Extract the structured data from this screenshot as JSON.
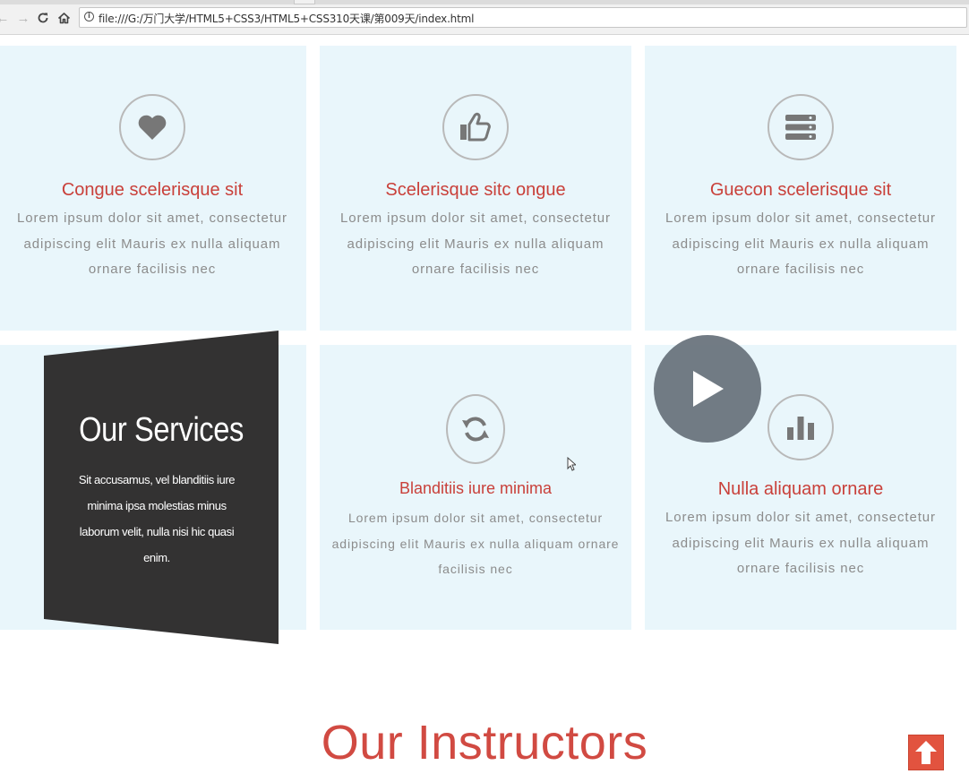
{
  "browser": {
    "url": "file:///G:/万门大学/HTML5+CSS3/HTML5+CSS310天课/第009天/index.html",
    "icons": [
      "back-icon",
      "forward-icon",
      "reload-icon",
      "home-icon",
      "info-icon"
    ]
  },
  "services": [
    {
      "icon": "heart-icon",
      "title": "Congue scelerisque sit",
      "text": "Lorem ipsum dolor sit amet, consectetur adipiscing elit Mauris ex nulla aliquam ornare facilisis nec"
    },
    {
      "icon": "thumbs-up-icon",
      "title": "Scelerisque sitc ongue",
      "text": "Lorem ipsum dolor sit amet, consectetur adipiscing elit Mauris ex nulla aliquam ornare facilisis nec"
    },
    {
      "icon": "server-icon",
      "title": "Guecon scelerisque sit",
      "text": "Lorem ipsum dolor sit amet, consectetur adipiscing elit Mauris ex nulla aliquam ornare facilisis nec"
    },
    {
      "icon": "refresh-icon",
      "title": "Blanditiis iure minima",
      "text": "Lorem ipsum dolor sit amet, consectetur adipiscing elit Mauris ex nulla aliquam ornare facilisis nec"
    },
    {
      "icon": "bar-chart-icon",
      "title": "Nulla aliquam ornare",
      "text": "Lorem ipsum dolor sit amet, consectetur adipiscing elit Mauris ex nulla aliquam ornare facilisis nec"
    }
  ],
  "overlay": {
    "title": "Our Services",
    "text": "Sit accusamus, vel blanditiis iure minima ipsa molestias minus laborum velit, nulla nisi hic quasi enim."
  },
  "play_button": {
    "icon": "play-icon"
  },
  "instructors": {
    "title": "Our Instructors"
  },
  "back_to_top": {
    "icon": "arrow-up-icon"
  },
  "colors": {
    "accent_red": "#c9403a",
    "card_bg": "#e9f6fb",
    "overlay_bg": "#333232",
    "body_text": "#8c8c8c",
    "back_to_top_bg": "#e2533f"
  }
}
